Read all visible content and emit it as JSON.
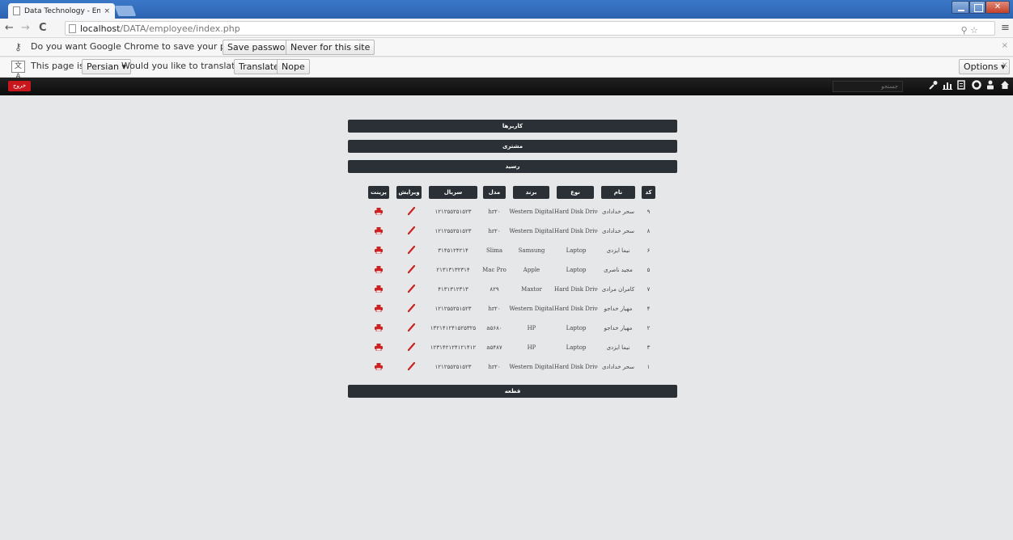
{
  "browser": {
    "tab_title": "Data Technology - Emplo",
    "tab_close": "×",
    "url_host": "localhost",
    "url_path": "/DATA/employee/index.php",
    "password_bar": {
      "message": "Do you want Google Chrome to save your password?",
      "save_label": "Save password",
      "never_label": "Never for this site",
      "close": "×"
    },
    "translate_bar": {
      "icon": "文A",
      "prefix": "This page is in",
      "language": "Persian ▾",
      "question": "Would you like to translate it?",
      "translate_label": "Translate",
      "nope_label": "Nope",
      "options_label": "Options ▾",
      "close": "×"
    }
  },
  "site": {
    "logout_label": "خروج",
    "search_placeholder": "جستجو",
    "menu": [
      "کاربرها",
      "مشتری",
      "رسید"
    ],
    "footer_menu": "قطعه",
    "columns": [
      "کد",
      "نام",
      "نوع",
      "برند",
      "مدل",
      "سریال",
      "ویرایش",
      "پرینت"
    ],
    "rows": [
      {
        "code": "۹",
        "name": "سحر خدادادی",
        "type": "Hard Disk Drive",
        "brand": "Western Digital",
        "model": "hr۲۰",
        "serial": "۱۲۱۲۵۵۲۵۱۵۲۳"
      },
      {
        "code": "۸",
        "name": "سحر خدادادی",
        "type": "Hard Disk Drive",
        "brand": "Western Digital",
        "model": "hr۲۰",
        "serial": "۱۲۱۲۵۵۲۵۱۵۲۳"
      },
      {
        "code": "۶",
        "name": "نیما ایزدی",
        "type": "Laptop",
        "brand": "Samsung",
        "model": "Slima",
        "serial": "۳۱۴۵۱۲۴۲۱۴"
      },
      {
        "code": "۵",
        "name": "مجید ناصری",
        "type": "Laptop",
        "brand": "Apple",
        "model": "Mac Pro",
        "serial": "۲۱۳۱۳۱۳۲۳۱۴"
      },
      {
        "code": "۷",
        "name": "کامران مرادی",
        "type": "Hard Disk Drive",
        "brand": "Maxtor",
        "model": "۸۲۹",
        "serial": "۴۱۳۱۳۱۲۳۱۳"
      },
      {
        "code": "۴",
        "name": "مهیار خداجو",
        "type": "Hard Disk Drive",
        "brand": "Western Digital",
        "model": "hr۲۰",
        "serial": "۱۲۱۲۵۵۲۵۱۵۲۳"
      },
      {
        "code": "۲",
        "name": "مهیار خداجو",
        "type": "Laptop",
        "brand": "HP",
        "model": "a۵۶۸۰",
        "serial": "۱۳۲۱۴۱۲۴۱۵۲۵۳۲۵"
      },
      {
        "code": "۳",
        "name": "نیما ایزدی",
        "type": "Laptop",
        "brand": "HP",
        "model": "a۵۴۸۷",
        "serial": "۱۲۳۱۴۲۱۲۴۱۲۱۴۱۲"
      },
      {
        "code": "۱",
        "name": "سحر خدادادی",
        "type": "Hard Disk Drive",
        "brand": "Western Digital",
        "model": "hr۲۰",
        "serial": "۱۲۱۲۵۵۲۵۱۵۲۳"
      }
    ]
  },
  "icons": {
    "nav": [
      "home-icon",
      "user-icon",
      "settings-icon",
      "document-icon",
      "chart-icon",
      "wrench-icon"
    ],
    "row_actions": [
      "edit-icon",
      "print-icon"
    ]
  },
  "colors": {
    "header_dark": "#2a3035",
    "logout_red": "#c8161b",
    "icon_red": "#cc2222",
    "background": "#e6e7e8"
  }
}
